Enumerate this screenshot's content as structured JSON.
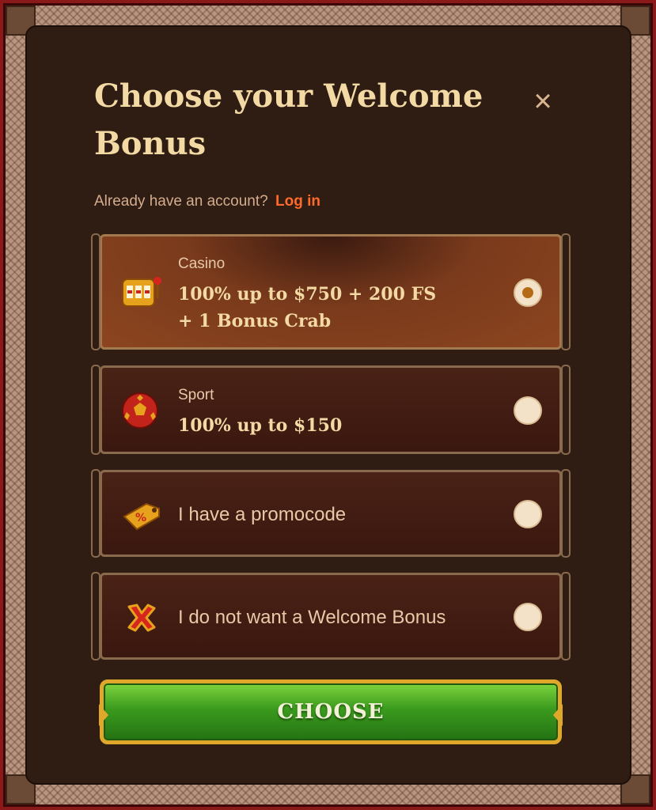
{
  "modal": {
    "title": "Choose your Welcome Bonus",
    "close_symbol": "×",
    "account_prompt": "Already have an account?",
    "login_link": "Log in"
  },
  "options": [
    {
      "label": "Casino",
      "value_line1": "100% up to $750 + 200 FS",
      "value_line2": "+ 1 Bonus Crab",
      "icon": "slot-machine-icon",
      "selected": true
    },
    {
      "label": "Sport",
      "value_line1": "100% up to $150",
      "icon": "soccer-ball-icon",
      "selected": false
    },
    {
      "text": "I have a promocode",
      "icon": "promo-tag-icon",
      "selected": false
    },
    {
      "text": "I do not want a Welcome Bonus",
      "icon": "red-x-icon",
      "selected": false
    }
  ],
  "choose_button": {
    "label": "CHOOSE"
  },
  "colors": {
    "title": "#f3d9a4",
    "login_link": "#ff6a2a",
    "button_green": "#3a9a1d",
    "button_border": "#e0a82a"
  }
}
